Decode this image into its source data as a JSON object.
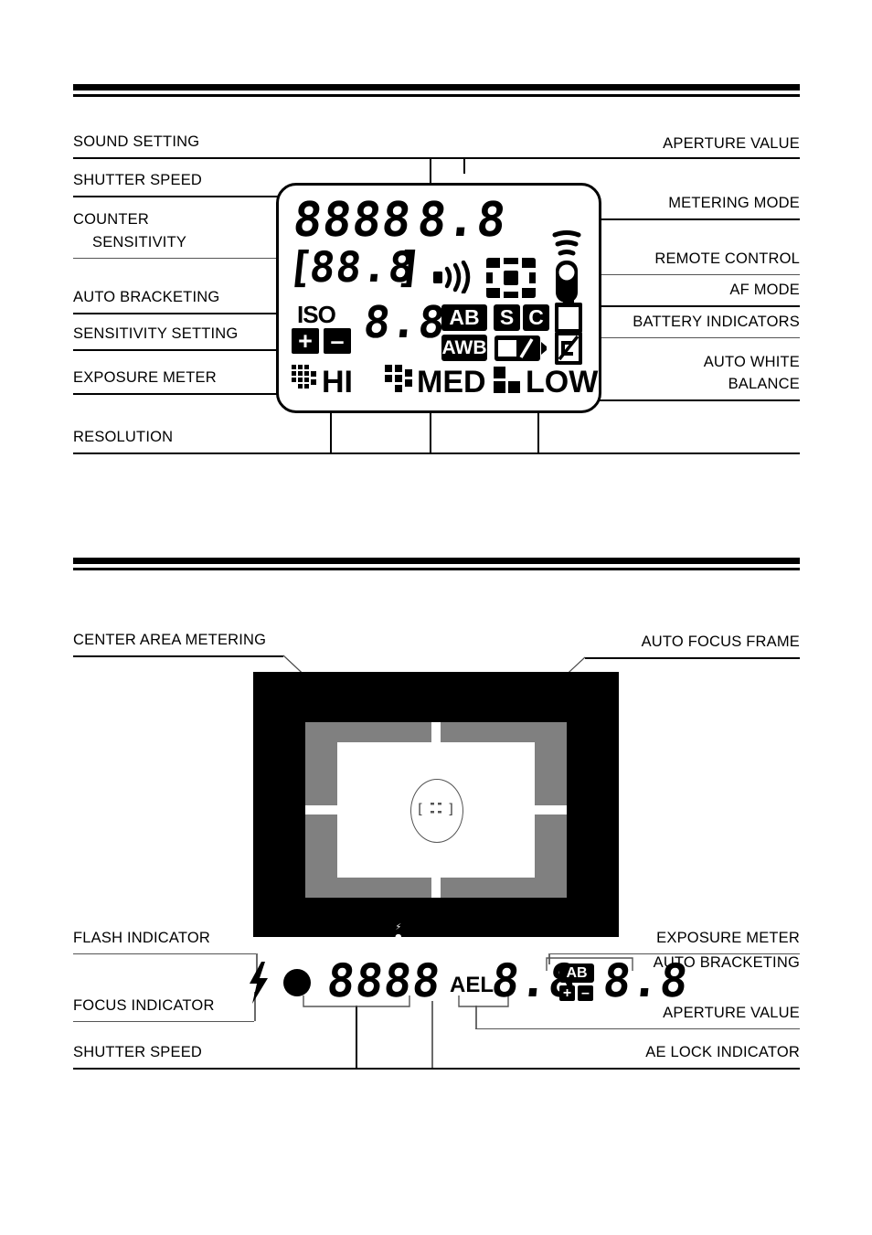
{
  "sections": {
    "lcd_panel": {
      "labels_left": [
        {
          "text": "SOUND SETTING",
          "name": "label-sound-setting"
        },
        {
          "text": "SHUTTER SPEED",
          "name": "label-shutter-speed"
        },
        {
          "text": "COUNTER",
          "name": "label-counter"
        },
        {
          "text": "SENSITIVITY",
          "name": "label-sensitivity"
        },
        {
          "text": "AUTO BRACKETING",
          "name": "label-auto-bracketing"
        },
        {
          "text": "SENSITIVITY SETTING",
          "name": "label-sensitivity-setting"
        },
        {
          "text": "EXPOSURE METER",
          "name": "label-exposure-meter"
        },
        {
          "text": "RESOLUTION",
          "name": "label-resolution"
        }
      ],
      "labels_right": [
        {
          "text": "APERTURE VALUE",
          "name": "label-aperture-value"
        },
        {
          "text": "METERING MODE",
          "name": "label-metering-mode"
        },
        {
          "text": "REMOTE CONTROL",
          "name": "label-remote-control"
        },
        {
          "text": "AF MODE",
          "name": "label-af-mode"
        },
        {
          "text": "BATTERY INDICATORS",
          "name": "label-battery-indicators"
        },
        {
          "text": "AUTO WHITE",
          "name": "label-auto-white"
        },
        {
          "text": "BALANCE",
          "name": "label-balance"
        }
      ],
      "display": {
        "shutter_speed": "8888",
        "aperture_value": "8.8",
        "counter_open": "[",
        "counter_value": "88.8",
        "counter_close": "]",
        "iso_label": "ISO",
        "sensitivity_value": "8.8",
        "plus_symbol": "+",
        "minus_symbol": "–",
        "badge_ab": "AB",
        "badge_awb": "AWB",
        "badge_s": "S",
        "badge_c": "C",
        "res_hi": "HI",
        "res_med": "MED",
        "res_low": "LOW",
        "icon_sound": "sound-waves-icon",
        "icon_metering": "metering-frame-icon",
        "icon_remote": "remote-control-icon",
        "icon_battery_main": "battery-full-icon",
        "icon_battery_second": "battery-second-icon",
        "icon_wb_mode": "white-balance-mode-icon"
      }
    },
    "viewfinder": {
      "labels_left": [
        {
          "text": "CENTER AREA METERING",
          "name": "label-center-area-metering"
        },
        {
          "text": "FLASH INDICATOR",
          "name": "label-flash-indicator"
        },
        {
          "text": "FOCUS INDICATOR",
          "name": "label-focus-indicator"
        },
        {
          "text": "SHUTTER SPEED",
          "name": "label-vf-shutter-speed"
        }
      ],
      "labels_right": [
        {
          "text": "AUTO FOCUS FRAME",
          "name": "label-auto-focus-frame"
        },
        {
          "text": "EXPOSURE METER",
          "name": "label-vf-exposure-meter"
        },
        {
          "text": "AUTO BRACKETING",
          "name": "label-vf-auto-bracketing"
        },
        {
          "text": "APERTURE VALUE",
          "name": "label-vf-aperture-value"
        },
        {
          "text": "AE LOCK INDICATOR",
          "name": "label-ae-lock-indicator"
        }
      ],
      "inner_strip": {
        "flash": "⚡",
        "focus": "●",
        "shutter_speed": "8888",
        "ael": "AEL",
        "aperture": "8.8",
        "bracket_icon": "AB",
        "exposure": "8.8"
      },
      "readout": {
        "flash_icon": "flash-bolt-icon",
        "focus_icon": "focus-dot-icon",
        "shutter_speed": "8888",
        "ael": "AEL",
        "aperture_value": "8.8",
        "badge_ab": "AB",
        "plus_symbol": "+",
        "minus_symbol": "–",
        "exposure_value": "8.8"
      },
      "focus_brackets": {
        "left": "[",
        "right": "]"
      }
    }
  },
  "colors": {
    "ink": "#000000",
    "viewfinder_gray": "#808080",
    "viewfinder_black": "#000000",
    "leader_gray": "#6b6b6b"
  }
}
